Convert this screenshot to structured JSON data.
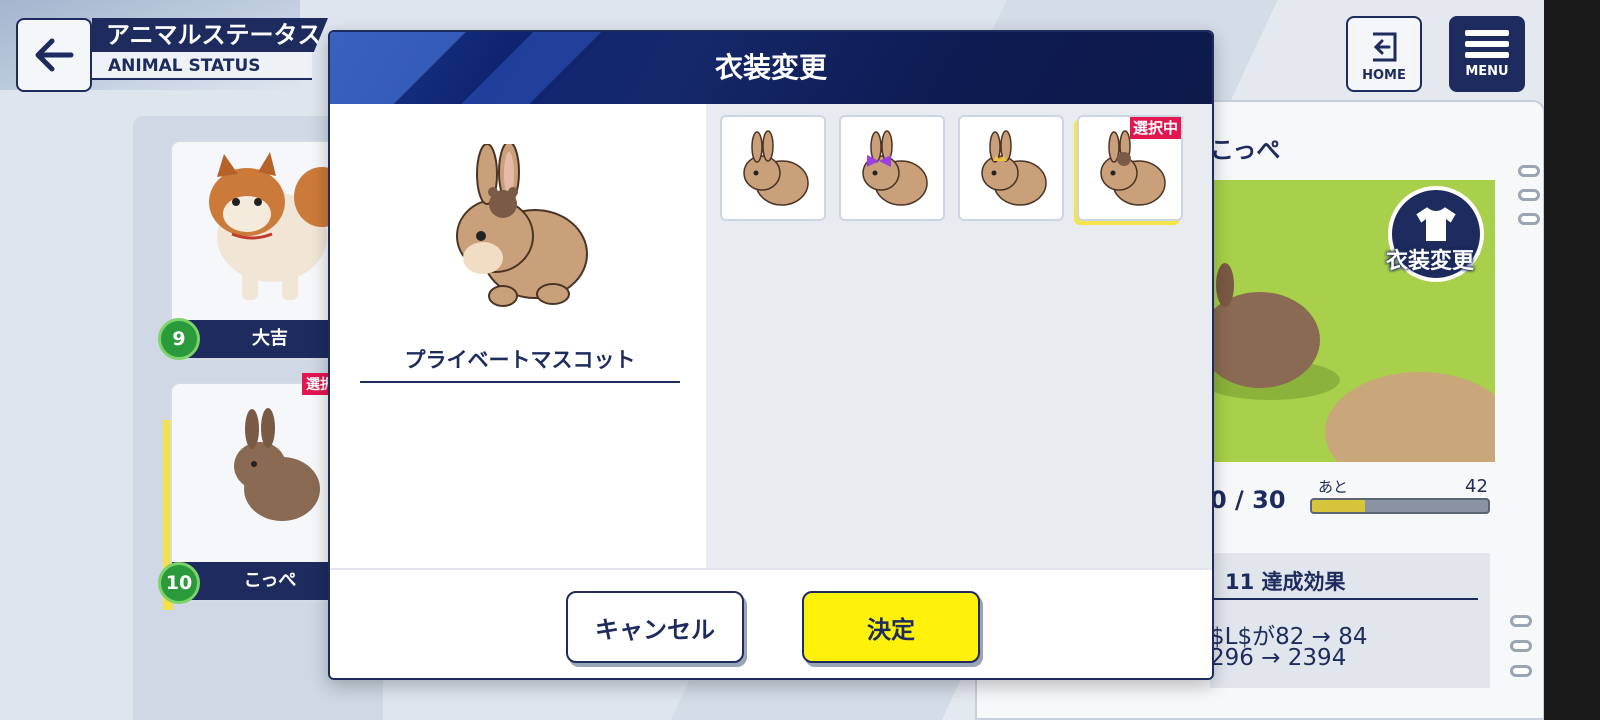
{
  "header": {
    "title_jp": "アニマルステータス",
    "title_en": "ANIMAL STATUS",
    "home_label": "HOME",
    "menu_label": "MENU"
  },
  "animal_list": [
    {
      "name": "大吉",
      "level": "9"
    },
    {
      "name": "こっぺ",
      "level": "10",
      "badge": "選択"
    }
  ],
  "detail": {
    "name": "こっぺ",
    "costume_button": "衣装変更",
    "count": "0 / 30",
    "ato_label": "あと",
    "ato_value": "42",
    "progress": 0.3,
    "effect_title": "11 達成効果",
    "effect_line1": "$L$が82 → 84",
    "effect_line2": "296 → 2394"
  },
  "modal": {
    "title": "衣装変更",
    "preview_name": "プライベートマスコット",
    "selected_badge": "選択中",
    "costumes": [
      {
        "icon": "bunny-plain-icon"
      },
      {
        "icon": "bunny-purple-bow-icon"
      },
      {
        "icon": "bunny-gold-crown-icon"
      },
      {
        "icon": "bunny-bear-hat-icon",
        "selected": true
      }
    ],
    "cancel_label": "キャンセル",
    "ok_label": "決定"
  },
  "colors": {
    "navy": "#1d2b5e",
    "accent_yellow": "#fff20a",
    "badge_red": "#e3164f",
    "level_green": "#2a9a3a"
  }
}
